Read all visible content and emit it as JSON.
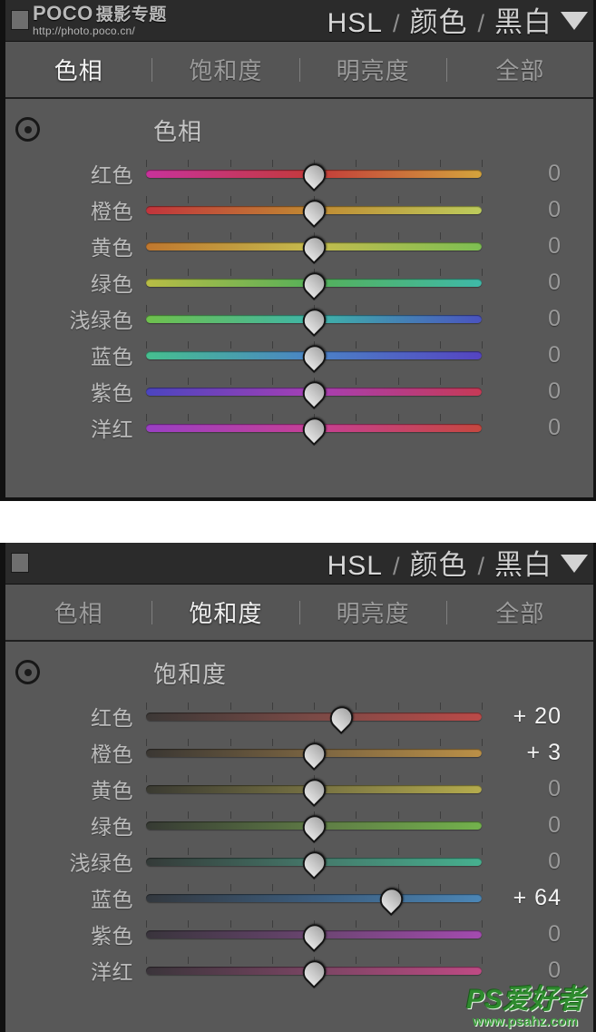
{
  "panels": [
    {
      "id": "hue-panel",
      "titlebar": {
        "hsl": "HSL",
        "sep1": "/",
        "color": "颜色",
        "sep2": "/",
        "bw": "黑白",
        "caret": "chevron-down-icon"
      },
      "tabs": [
        {
          "label": "色相",
          "active": true
        },
        {
          "label": "饱和度",
          "active": false
        },
        {
          "label": "明亮度",
          "active": false
        },
        {
          "label": "全部",
          "active": false
        }
      ],
      "section_title": "色相",
      "target_icon": "target-selector-icon",
      "sliders": [
        {
          "label": "红色",
          "value": "0",
          "pos": 50,
          "nonzero": false,
          "from": "#c8329b",
          "mid": "#c33a3a",
          "to": "#d4a33c"
        },
        {
          "label": "橙色",
          "value": "0",
          "pos": 50,
          "nonzero": false,
          "from": "#c2343c",
          "mid": "#c08a32",
          "to": "#bdcc5c"
        },
        {
          "label": "黄色",
          "value": "0",
          "pos": 50,
          "nonzero": false,
          "from": "#c0772e",
          "mid": "#c4bc4e",
          "to": "#7dbf52"
        },
        {
          "label": "绿色",
          "value": "0",
          "pos": 50,
          "nonzero": false,
          "from": "#b9bd45",
          "mid": "#55b059",
          "to": "#3fb9a8"
        },
        {
          "label": "浅绿色",
          "value": "0",
          "pos": 50,
          "nonzero": false,
          "from": "#6fc14c",
          "mid": "#3eb5a8",
          "to": "#4a53c0"
        },
        {
          "label": "蓝色",
          "value": "0",
          "pos": 50,
          "nonzero": false,
          "from": "#46c08f",
          "mid": "#4b83c6",
          "to": "#5544c2"
        },
        {
          "label": "紫色",
          "value": "0",
          "pos": 50,
          "nonzero": false,
          "from": "#4b45bf",
          "mid": "#a63fb4",
          "to": "#c63a56"
        },
        {
          "label": "洋红",
          "value": "0",
          "pos": 50,
          "nonzero": false,
          "from": "#9a3fc4",
          "mid": "#c63f94",
          "to": "#c6473f"
        }
      ]
    },
    {
      "id": "saturation-panel",
      "titlebar": {
        "hsl": "HSL",
        "sep1": "/",
        "color": "颜色",
        "sep2": "/",
        "bw": "黑白",
        "caret": "chevron-down-icon"
      },
      "tabs": [
        {
          "label": "色相",
          "active": false
        },
        {
          "label": "饱和度",
          "active": true
        },
        {
          "label": "明亮度",
          "active": false
        },
        {
          "label": "全部",
          "active": false
        }
      ],
      "section_title": "饱和度",
      "target_icon": "target-selector-icon",
      "sliders": [
        {
          "label": "红色",
          "value": "+ 20",
          "pos": 58,
          "nonzero": true,
          "from": "#3c3836",
          "mid": "#7a4a46",
          "to": "#bb4a48"
        },
        {
          "label": "橙色",
          "value": "+ 3",
          "pos": 50,
          "nonzero": true,
          "from": "#3a3733",
          "mid": "#7a6441",
          "to": "#bb9047"
        },
        {
          "label": "黄色",
          "value": "0",
          "pos": 50,
          "nonzero": false,
          "from": "#3a3a32",
          "mid": "#767142",
          "to": "#b5ac4d"
        },
        {
          "label": "绿色",
          "value": "0",
          "pos": 50,
          "nonzero": false,
          "from": "#363a33",
          "mid": "#5e7a45",
          "to": "#73b24c"
        },
        {
          "label": "浅绿色",
          "value": "0",
          "pos": 50,
          "nonzero": false,
          "from": "#343a38",
          "mid": "#45786a",
          "to": "#46b08f"
        },
        {
          "label": "蓝色",
          "value": "+ 64",
          "pos": 73,
          "nonzero": true,
          "from": "#33383e",
          "mid": "#3c5c7c",
          "to": "#4b86b6"
        },
        {
          "label": "紫色",
          "value": "0",
          "pos": 50,
          "nonzero": false,
          "from": "#39343c",
          "mid": "#6a4570",
          "to": "#a44bb0"
        },
        {
          "label": "洋红",
          "value": "0",
          "pos": 50,
          "nonzero": false,
          "from": "#3a343a",
          "mid": "#7a4563",
          "to": "#bf4a84"
        }
      ]
    }
  ],
  "watermarks": {
    "poco": {
      "brand": "POCO",
      "brand_zh": "摄影专题",
      "url": "http://photo.poco.cn/"
    },
    "psahz": {
      "logo": "PS爱好者",
      "url": "www.psahz.com"
    }
  }
}
